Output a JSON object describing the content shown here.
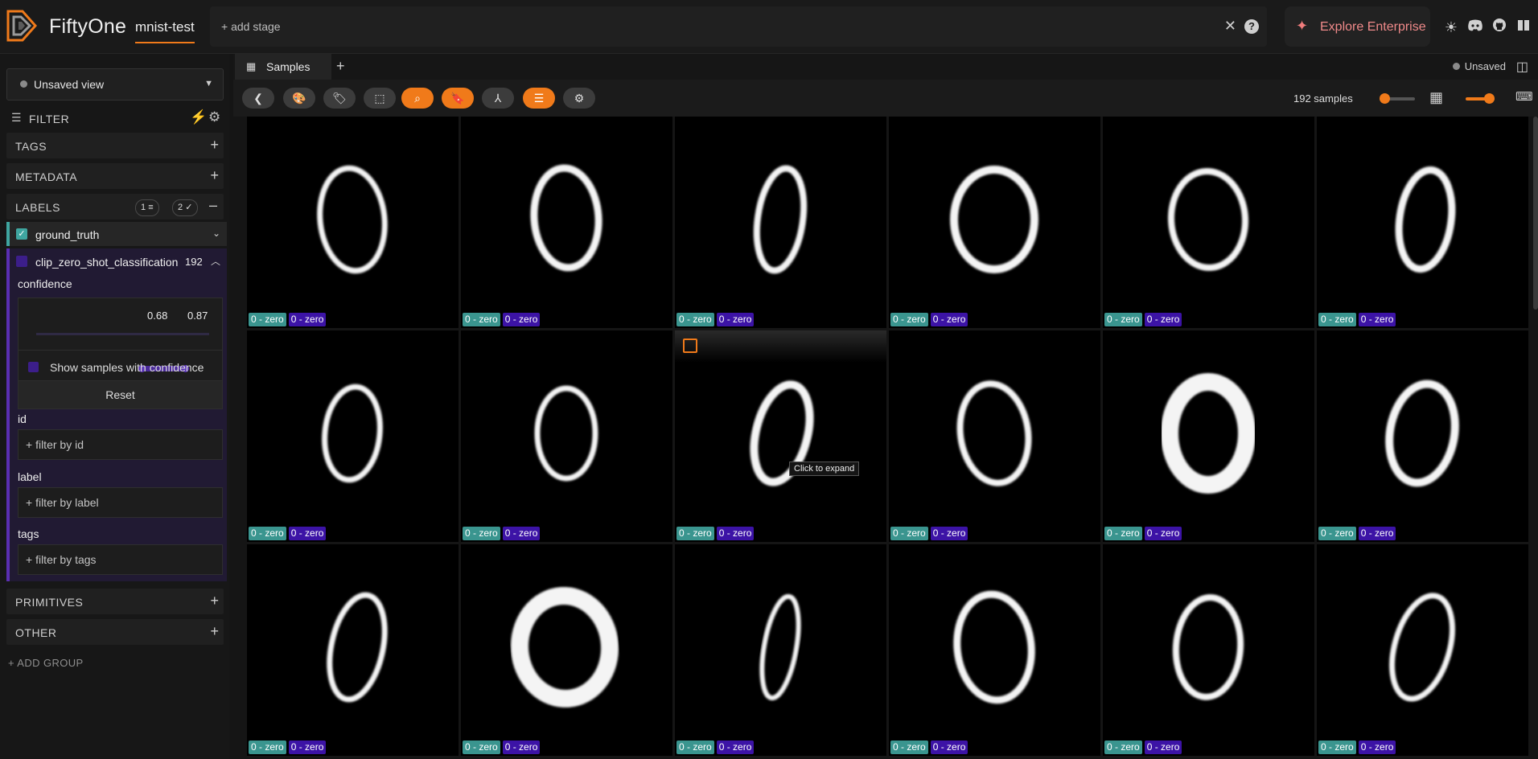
{
  "app": {
    "brand": "FiftyOne",
    "dataset_name": "mnist-test",
    "add_stage_label": "+ add stage",
    "enterprise_label": "Explore Enterprise"
  },
  "sidebar": {
    "view_selector": "Unsaved view",
    "filter_label": "FILTER",
    "groups": {
      "tags": "TAGS",
      "metadata": "METADATA",
      "labels": "LABELS",
      "primitives": "PRIMITIVES",
      "other": "OTHER"
    },
    "labels_chip_filters": "1",
    "labels_chip_visible": "2",
    "ground_truth_label": "ground_truth",
    "clip_field": {
      "name": "clip_zero_shot_classification",
      "count": "192",
      "confidence_label": "confidence",
      "confidence_min": "0.68",
      "confidence_max": "0.87",
      "range_fraction": [
        0.61,
        0.86
      ],
      "show_samples_label": "Show samples with confidence",
      "reset_label": "Reset",
      "id_label": "id",
      "id_placeholder": "+ filter by id",
      "label_label": "label",
      "label_placeholder": "+ filter by label",
      "tags_label": "tags",
      "tags_placeholder": "+ filter by tags"
    },
    "add_group_label": "+ ADD GROUP"
  },
  "main": {
    "tab_label": "Samples",
    "unsaved_label": "Unsaved",
    "sample_count": "192 samples",
    "tooltip": "Click to expand",
    "colors": {
      "accent": "#f07a1a",
      "ground_truth": "#3a958f",
      "clip": "#3c13a6"
    },
    "samples": [
      {
        "gt": "0 - zero",
        "clip": "0 - zero"
      },
      {
        "gt": "0 - zero",
        "clip": "0 - zero"
      },
      {
        "gt": "0 - zero",
        "clip": "0 - zero"
      },
      {
        "gt": "0 - zero",
        "clip": "0 - zero"
      },
      {
        "gt": "0 - zero",
        "clip": "0 - zero"
      },
      {
        "gt": "0 - zero",
        "clip": "0 - zero"
      },
      {
        "gt": "0 - zero",
        "clip": "0 - zero"
      },
      {
        "gt": "0 - zero",
        "clip": "0 - zero"
      },
      {
        "gt": "0 - zero",
        "clip": "0 - zero"
      },
      {
        "gt": "0 - zero",
        "clip": "0 - zero"
      },
      {
        "gt": "0 - zero",
        "clip": "0 - zero"
      },
      {
        "gt": "0 - zero",
        "clip": "0 - zero"
      },
      {
        "gt": "0 - zero",
        "clip": "0 - zero"
      },
      {
        "gt": "0 - zero",
        "clip": "0 - zero"
      },
      {
        "gt": "0 - zero",
        "clip": "0 - zero"
      },
      {
        "gt": "0 - zero",
        "clip": "0 - zero"
      },
      {
        "gt": "0 - zero",
        "clip": "0 - zero"
      },
      {
        "gt": "0 - zero",
        "clip": "0 - zero"
      }
    ]
  }
}
